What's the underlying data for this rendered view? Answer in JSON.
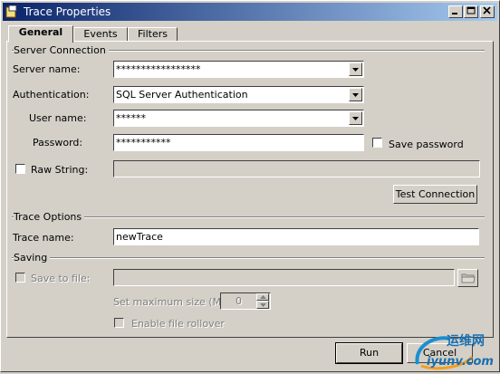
{
  "window": {
    "title": "Trace Properties"
  },
  "tabs": [
    "General",
    "Events",
    "Filters"
  ],
  "server_connection": {
    "section_label": "Server Connection",
    "server_name_label": "Server name:",
    "server_name_value": "*****************",
    "authentication_label": "Authentication:",
    "authentication_value": "SQL Server Authentication",
    "user_name_label": "User name:",
    "user_name_value": "******",
    "password_label": "Password:",
    "password_value": "***********",
    "save_password_label": "Save password",
    "raw_string_label": "Raw String:",
    "test_connection_label": "Test Connection"
  },
  "trace_options": {
    "section_label": "Trace Options",
    "trace_name_label": "Trace name:",
    "trace_name_value": "newTrace"
  },
  "saving": {
    "section_label": "Saving",
    "save_to_file_label": "Save to file:",
    "max_size_label": "Set maximum size (MB)",
    "max_size_value": "0",
    "file_rollover_label": "Enable file rollover"
  },
  "buttons": {
    "run": "Run",
    "cancel": "Cancel"
  },
  "watermark": {
    "text_cn": "运维网",
    "text_url": "iyunv.com"
  }
}
